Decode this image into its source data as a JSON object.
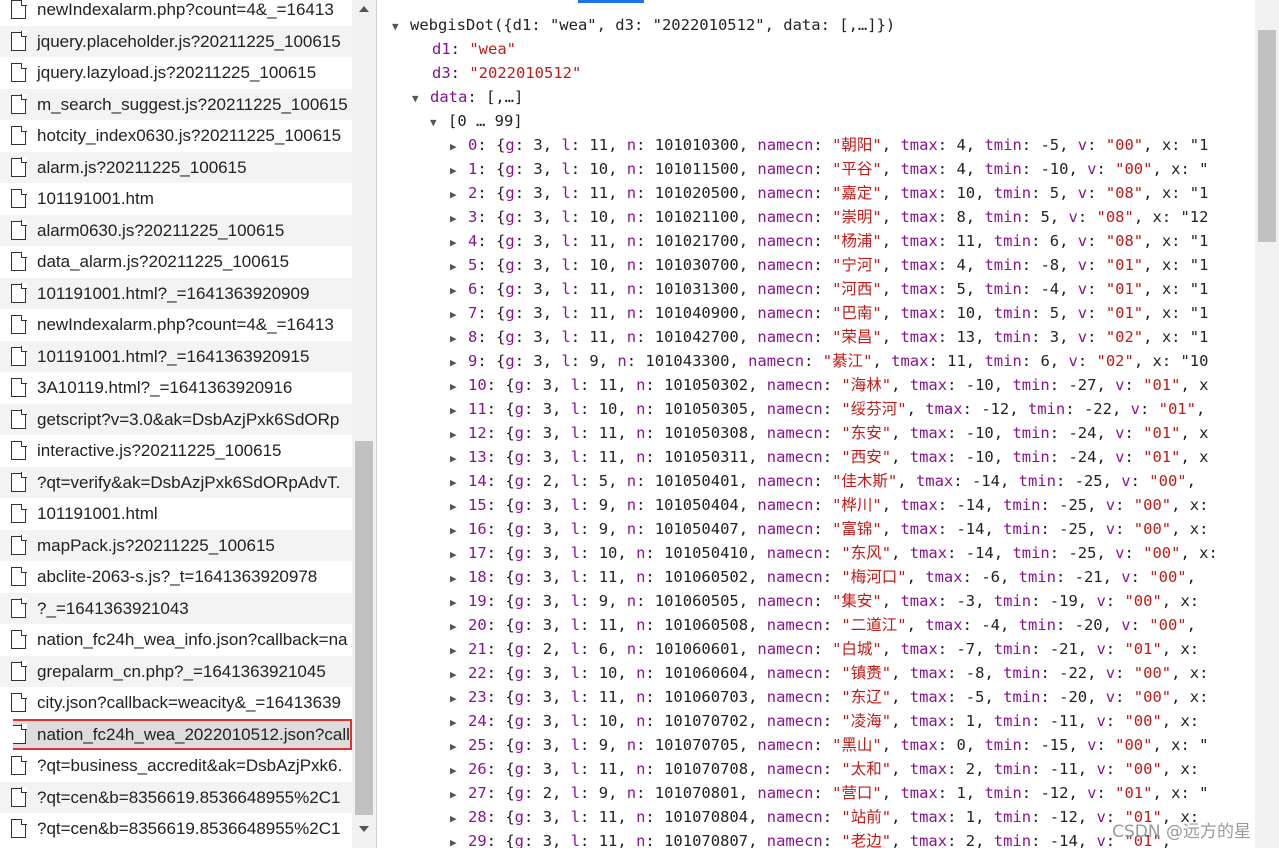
{
  "files": [
    "newIndexalarm.php?count=4&_=16413",
    "jquery.placeholder.js?20211225_100615",
    "jquery.lazyload.js?20211225_100615",
    "m_search_suggest.js?20211225_100615",
    "hotcity_index0630.js?20211225_100615",
    "alarm.js?20211225_100615",
    "101191001.htm",
    "alarm0630.js?20211225_100615",
    "data_alarm.js?20211225_100615",
    "101191001.html?_=1641363920909",
    "newIndexalarm.php?count=4&_=16413",
    "101191001.html?_=1641363920915",
    "3A10119.html?_=1641363920916",
    "getscript?v=3.0&ak=DsbAzjPxk6SdORp",
    "interactive.js?20211225_100615",
    "?qt=verify&ak=DsbAzjPxk6SdORpAdvT.",
    "101191001.html",
    "mapPack.js?20211225_100615",
    "abclite-2063-s.js?_t=1641363920978",
    "?_=1641363921043",
    "nation_fc24h_wea_info.json?callback=na",
    "grepalarm_cn.php?_=1641363921045",
    "city.json?callback=weacity&_=16413639",
    "nation_fc24h_wea_2022010512.json?call",
    "?qt=business_accredit&ak=DsbAzjPxk6.",
    "?qt=cen&b=8356619.8536648955%2C1",
    "?qt=cen&b=8356619.8536648955%2C1"
  ],
  "selected_file_index": 23,
  "preview": {
    "root_call": "webgisDot({d1: \"wea\", d3: \"2022010512\", data: [,…]})",
    "d1": {
      "key": "d1",
      "value": "\"wea\""
    },
    "d3": {
      "key": "d3",
      "value": "\"2022010512\""
    },
    "data_node": {
      "key": "data",
      "summary": "[,…]"
    },
    "range_label": "[0 … 99]",
    "entries": [
      {
        "i": "0",
        "g": "3",
        "l": "11",
        "n": "101010300",
        "namecn": "\"朝阳\"",
        "tmax": "4",
        "tmin": "-5",
        "v": "\"00\"",
        "tail": "x: \"1"
      },
      {
        "i": "1",
        "g": "3",
        "l": "10",
        "n": "101011500",
        "namecn": "\"平谷\"",
        "tmax": "4",
        "tmin": "-10",
        "v": "\"00\"",
        "tail": "x: \""
      },
      {
        "i": "2",
        "g": "3",
        "l": "11",
        "n": "101020500",
        "namecn": "\"嘉定\"",
        "tmax": "10",
        "tmin": "5",
        "v": "\"08\"",
        "tail": "x: \"1"
      },
      {
        "i": "3",
        "g": "3",
        "l": "10",
        "n": "101021100",
        "namecn": "\"崇明\"",
        "tmax": "8",
        "tmin": "5",
        "v": "\"08\"",
        "tail": "x: \"12"
      },
      {
        "i": "4",
        "g": "3",
        "l": "11",
        "n": "101021700",
        "namecn": "\"杨浦\"",
        "tmax": "11",
        "tmin": "6",
        "v": "\"08\"",
        "tail": "x: \"1"
      },
      {
        "i": "5",
        "g": "3",
        "l": "10",
        "n": "101030700",
        "namecn": "\"宁河\"",
        "tmax": "4",
        "tmin": "-8",
        "v": "\"01\"",
        "tail": "x: \"1"
      },
      {
        "i": "6",
        "g": "3",
        "l": "11",
        "n": "101031300",
        "namecn": "\"河西\"",
        "tmax": "5",
        "tmin": "-4",
        "v": "\"01\"",
        "tail": "x: \"1"
      },
      {
        "i": "7",
        "g": "3",
        "l": "11",
        "n": "101040900",
        "namecn": "\"巴南\"",
        "tmax": "10",
        "tmin": "5",
        "v": "\"01\"",
        "tail": "x: \"1"
      },
      {
        "i": "8",
        "g": "3",
        "l": "11",
        "n": "101042700",
        "namecn": "\"荣昌\"",
        "tmax": "13",
        "tmin": "3",
        "v": "\"02\"",
        "tail": "x: \"1"
      },
      {
        "i": "9",
        "g": "3",
        "l": "9",
        "n": "101043300",
        "namecn": "\"綦江\"",
        "tmax": "11",
        "tmin": "6",
        "v": "\"02\"",
        "tail": "x: \"10"
      },
      {
        "i": "10",
        "g": "3",
        "l": "11",
        "n": "101050302",
        "namecn": "\"海林\"",
        "tmax": "-10",
        "tmin": "-27",
        "v": "\"01\"",
        "tail": "x"
      },
      {
        "i": "11",
        "g": "3",
        "l": "10",
        "n": "101050305",
        "namecn": "\"绥芬河\"",
        "tmax": "-12",
        "tmin": "-22",
        "v": "\"01\"",
        "tail": ""
      },
      {
        "i": "12",
        "g": "3",
        "l": "11",
        "n": "101050308",
        "namecn": "\"东安\"",
        "tmax": "-10",
        "tmin": "-24",
        "v": "\"01\"",
        "tail": "x"
      },
      {
        "i": "13",
        "g": "3",
        "l": "11",
        "n": "101050311",
        "namecn": "\"西安\"",
        "tmax": "-10",
        "tmin": "-24",
        "v": "\"01\"",
        "tail": "x"
      },
      {
        "i": "14",
        "g": "2",
        "l": "5",
        "n": "101050401",
        "namecn": "\"佳木斯\"",
        "tmax": "-14",
        "tmin": "-25",
        "v": "\"00\"",
        "tail": ""
      },
      {
        "i": "15",
        "g": "3",
        "l": "9",
        "n": "101050404",
        "namecn": "\"桦川\"",
        "tmax": "-14",
        "tmin": "-25",
        "v": "\"00\"",
        "tail": "x:"
      },
      {
        "i": "16",
        "g": "3",
        "l": "9",
        "n": "101050407",
        "namecn": "\"富锦\"",
        "tmax": "-14",
        "tmin": "-25",
        "v": "\"00\"",
        "tail": "x:"
      },
      {
        "i": "17",
        "g": "3",
        "l": "10",
        "n": "101050410",
        "namecn": "\"东风\"",
        "tmax": "-14",
        "tmin": "-25",
        "v": "\"00\"",
        "tail": "x:"
      },
      {
        "i": "18",
        "g": "3",
        "l": "11",
        "n": "101060502",
        "namecn": "\"梅河口\"",
        "tmax": "-6",
        "tmin": "-21",
        "v": "\"00\"",
        "tail": ""
      },
      {
        "i": "19",
        "g": "3",
        "l": "9",
        "n": "101060505",
        "namecn": "\"集安\"",
        "tmax": "-3",
        "tmin": "-19",
        "v": "\"00\"",
        "tail": "x:"
      },
      {
        "i": "20",
        "g": "3",
        "l": "11",
        "n": "101060508",
        "namecn": "\"二道江\"",
        "tmax": "-4",
        "tmin": "-20",
        "v": "\"00\"",
        "tail": ""
      },
      {
        "i": "21",
        "g": "2",
        "l": "6",
        "n": "101060601",
        "namecn": "\"白城\"",
        "tmax": "-7",
        "tmin": "-21",
        "v": "\"01\"",
        "tail": "x:"
      },
      {
        "i": "22",
        "g": "3",
        "l": "10",
        "n": "101060604",
        "namecn": "\"镇赉\"",
        "tmax": "-8",
        "tmin": "-22",
        "v": "\"00\"",
        "tail": "x:"
      },
      {
        "i": "23",
        "g": "3",
        "l": "11",
        "n": "101060703",
        "namecn": "\"东辽\"",
        "tmax": "-5",
        "tmin": "-20",
        "v": "\"00\"",
        "tail": "x:"
      },
      {
        "i": "24",
        "g": "3",
        "l": "10",
        "n": "101070702",
        "namecn": "\"凌海\"",
        "tmax": "1",
        "tmin": "-11",
        "v": "\"00\"",
        "tail": "x:"
      },
      {
        "i": "25",
        "g": "3",
        "l": "9",
        "n": "101070705",
        "namecn": "\"黑山\"",
        "tmax": "0",
        "tmin": "-15",
        "v": "\"00\"",
        "tail": "x: \""
      },
      {
        "i": "26",
        "g": "3",
        "l": "11",
        "n": "101070708",
        "namecn": "\"太和\"",
        "tmax": "2",
        "tmin": "-11",
        "v": "\"00\"",
        "tail": "x:"
      },
      {
        "i": "27",
        "g": "2",
        "l": "9",
        "n": "101070801",
        "namecn": "\"营口\"",
        "tmax": "1",
        "tmin": "-12",
        "v": "\"01\"",
        "tail": "x: \""
      },
      {
        "i": "28",
        "g": "3",
        "l": "11",
        "n": "101070804",
        "namecn": "\"站前\"",
        "tmax": "1",
        "tmin": "-12",
        "v": "\"01\"",
        "tail": "x:"
      },
      {
        "i": "29",
        "g": "3",
        "l": "11",
        "n": "101070807",
        "namecn": "\"老边\"",
        "tmax": "2",
        "tmin": "-14",
        "v": "\"01\"",
        "tail": ""
      }
    ]
  },
  "watermark": "CSDN @远方的星",
  "colors": {
    "selection_outline": "#e03030",
    "json_key": "#881391",
    "json_string": "#c41a16",
    "tab_indicator": "#1a73e8"
  }
}
